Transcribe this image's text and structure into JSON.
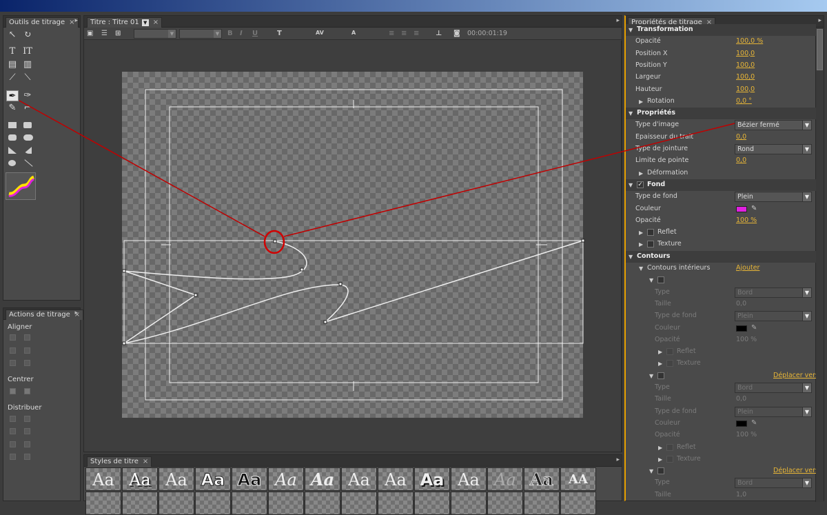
{
  "tools_panel": {
    "title": "Outils de titrage"
  },
  "actions_panel": {
    "title": "Actions de titrage",
    "align_label": "Aligner",
    "center_label": "Centrer",
    "distribute_label": "Distribuer"
  },
  "editor": {
    "tab_title": "Titre : Titre 01",
    "timecode": "00:00:01:19"
  },
  "styles_panel": {
    "title": "Styles de titre",
    "samples": [
      "Aa",
      "Aa",
      "Aa",
      "Aa",
      "Aa",
      "Aa",
      "Aa",
      "Aa",
      "Aa",
      "Aa",
      "Aa",
      "Aa",
      "Aa",
      "AA"
    ]
  },
  "props_panel": {
    "title": "Propriétés de titrage",
    "sections": {
      "transformation": "Transformation",
      "proprietes": "Propriétés",
      "fond": "Fond",
      "contours": "Contours"
    },
    "rows": {
      "opacite_label": "Opacité",
      "opacite_value": "100,0 %",
      "posx_label": "Position X",
      "posx_value": "100,0",
      "posy_label": "Position Y",
      "posy_value": "100,0",
      "largeur_label": "Largeur",
      "largeur_value": "100,0",
      "hauteur_label": "Hauteur",
      "hauteur_value": "100,0",
      "rotation_label": "Rotation",
      "rotation_value": "0,0 °",
      "type_image_label": "Type d'image",
      "type_image_value": "Bézier fermé",
      "epaisseur_label": "Epaisseur du trait",
      "epaisseur_value": "0,0",
      "jointure_label": "Type de jointure",
      "jointure_value": "Rond",
      "limite_label": "Limite de pointe",
      "limite_value": "0,0",
      "deformation_label": "Déformation",
      "type_fond_label": "Type de fond",
      "type_fond_value": "Plein",
      "couleur_label": "Couleur",
      "fond_opacite_label": "Opacité",
      "fond_opacite_value": "100 %",
      "reflet_label": "Reflet",
      "texture_label": "Texture",
      "contours_int_label": "Contours intérieurs",
      "ajouter_link": "Ajouter",
      "type_label": "Type",
      "type_value": "Bord",
      "taille_label": "Taille",
      "taille_value_1": "0,0",
      "taille_value_2": "0,0",
      "taille_value_3": "1,0",
      "sub_type_fond_label": "Type de fond",
      "sub_type_fond_value": "Plein",
      "sub_couleur_label": "Couleur",
      "sub_opacite_label": "Opacité",
      "sub_opacite_value": "100 %",
      "deplacer_link": "Déplacer vers"
    },
    "colors": {
      "fill": "#e020e0",
      "stroke_color": "#000000"
    }
  }
}
